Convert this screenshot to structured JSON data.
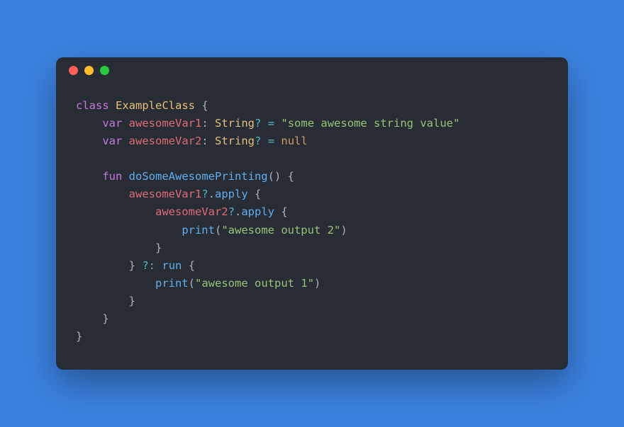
{
  "language": "kotlin",
  "window": {
    "traffic_lights": [
      "close",
      "minimize",
      "zoom"
    ]
  },
  "code": {
    "l1": {
      "kw": "class",
      "sp": " ",
      "name": "ExampleClass",
      "sp2": " ",
      "brace": "{"
    },
    "l2": {
      "indent": "    ",
      "kw": "var",
      "sp": " ",
      "name": "awesomeVar1",
      "colon": ": ",
      "type": "String",
      "q": "?",
      "sp2": " ",
      "eq": "=",
      "sp3": " ",
      "val": "\"some awesome string value\""
    },
    "l3": {
      "indent": "    ",
      "kw": "var",
      "sp": " ",
      "name": "awesomeVar2",
      "colon": ": ",
      "type": "String",
      "q": "?",
      "sp2": " ",
      "eq": "=",
      "sp3": " ",
      "val": "null"
    },
    "l4": {
      "blank": ""
    },
    "l5": {
      "indent": "    ",
      "kw": "fun",
      "sp": " ",
      "name": "doSomeAwesomePrinting",
      "parens": "()",
      "sp2": " ",
      "brace": "{"
    },
    "l6": {
      "indent": "        ",
      "name": "awesomeVar1",
      "q": "?",
      "dot": ".",
      "call": "apply",
      "sp": " ",
      "brace": "{"
    },
    "l7": {
      "indent": "            ",
      "name": "awesomeVar2",
      "q": "?",
      "dot": ".",
      "call": "apply",
      "sp": " ",
      "brace": "{"
    },
    "l8": {
      "indent": "                ",
      "call": "print",
      "open": "(",
      "arg": "\"awesome output 2\"",
      "close": ")"
    },
    "l9": {
      "indent": "            ",
      "brace": "}"
    },
    "l10": {
      "indent": "        ",
      "brace": "}",
      "sp": " ",
      "elvis": "?:",
      "sp2": " ",
      "call": "run",
      "sp3": " ",
      "brace2": "{"
    },
    "l11": {
      "indent": "            ",
      "call": "print",
      "open": "(",
      "arg": "\"awesome output 1\"",
      "close": ")"
    },
    "l12": {
      "indent": "        ",
      "brace": "}"
    },
    "l13": {
      "indent": "    ",
      "brace": "}"
    },
    "l14": {
      "brace": "}"
    }
  }
}
